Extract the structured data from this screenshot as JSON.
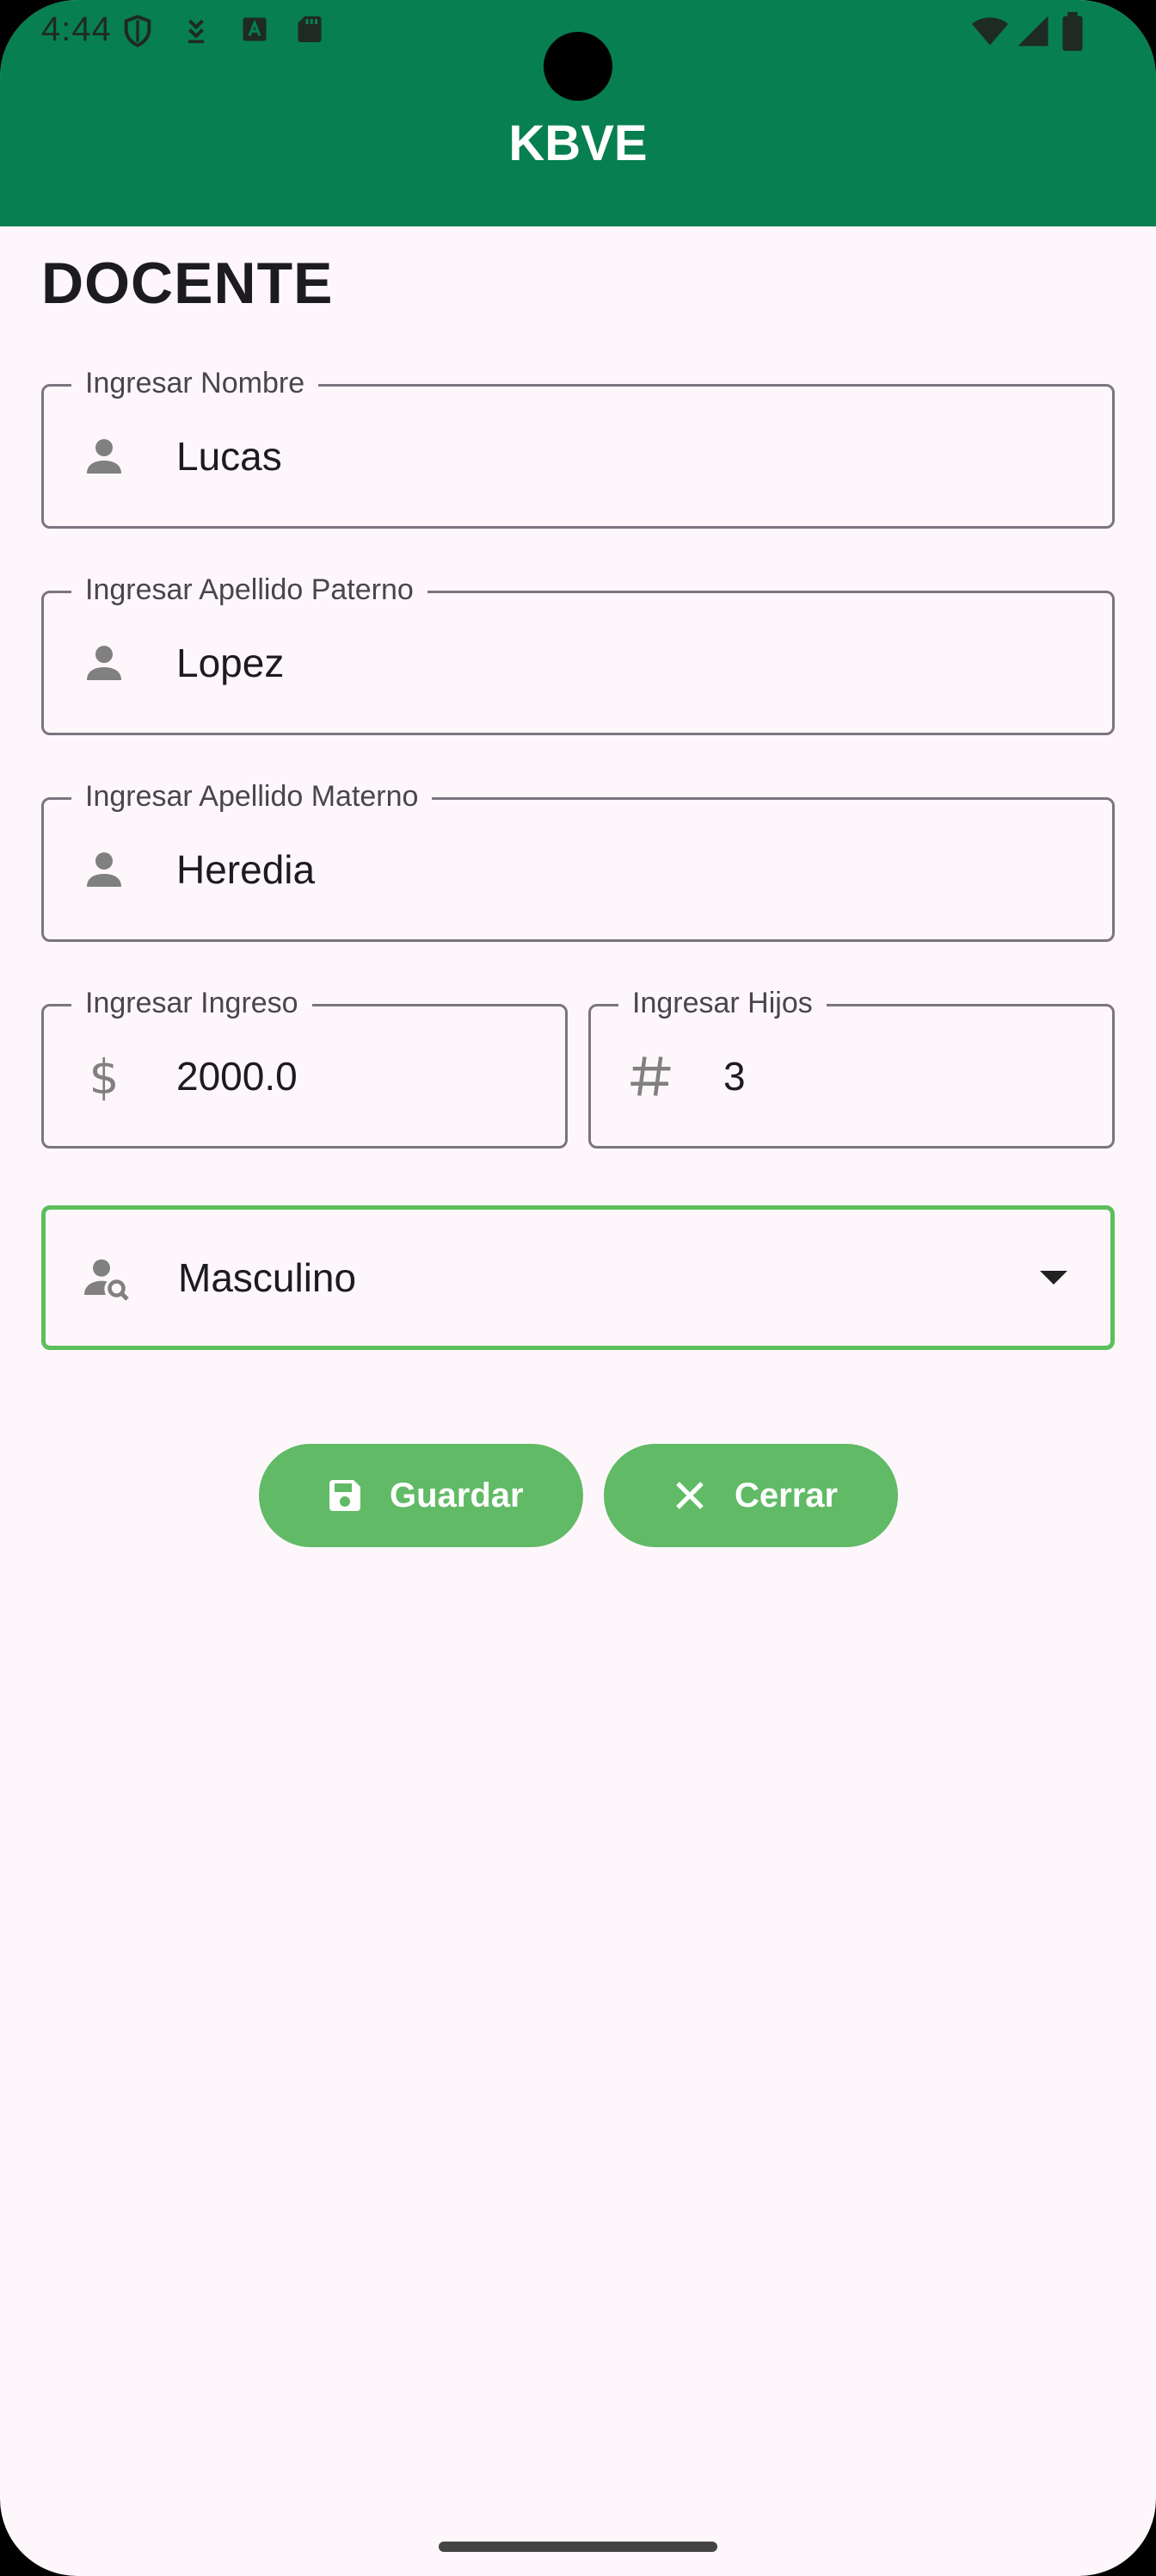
{
  "status_bar": {
    "time": "4:44"
  },
  "app_bar": {
    "title": "KBVE",
    "color": "#077f50"
  },
  "section_title": "DOCENTE",
  "form": {
    "nombre": {
      "label": "Ingresar Nombre",
      "value": "Lucas",
      "icon": "person-icon"
    },
    "apellido_paterno": {
      "label": "Ingresar Apellido Paterno",
      "value": "Lopez",
      "icon": "person-icon"
    },
    "apellido_materno": {
      "label": "Ingresar Apellido Materno",
      "value": "Heredia",
      "icon": "person-icon"
    },
    "ingreso": {
      "label": "Ingresar Ingreso",
      "value": "2000.0",
      "icon": "dollar-icon"
    },
    "hijos": {
      "label": "Ingresar Hijos",
      "value": "3",
      "icon": "hash-icon"
    },
    "genero": {
      "value": "Masculino",
      "icon": "person-search-icon"
    }
  },
  "buttons": {
    "guardar": {
      "label": "Guardar",
      "icon": "save-icon"
    },
    "cerrar": {
      "label": "Cerrar",
      "icon": "close-icon"
    },
    "color": "#61ba65"
  },
  "colors": {
    "focus_border": "#5cbf5c",
    "background": "#fdf7fb"
  }
}
